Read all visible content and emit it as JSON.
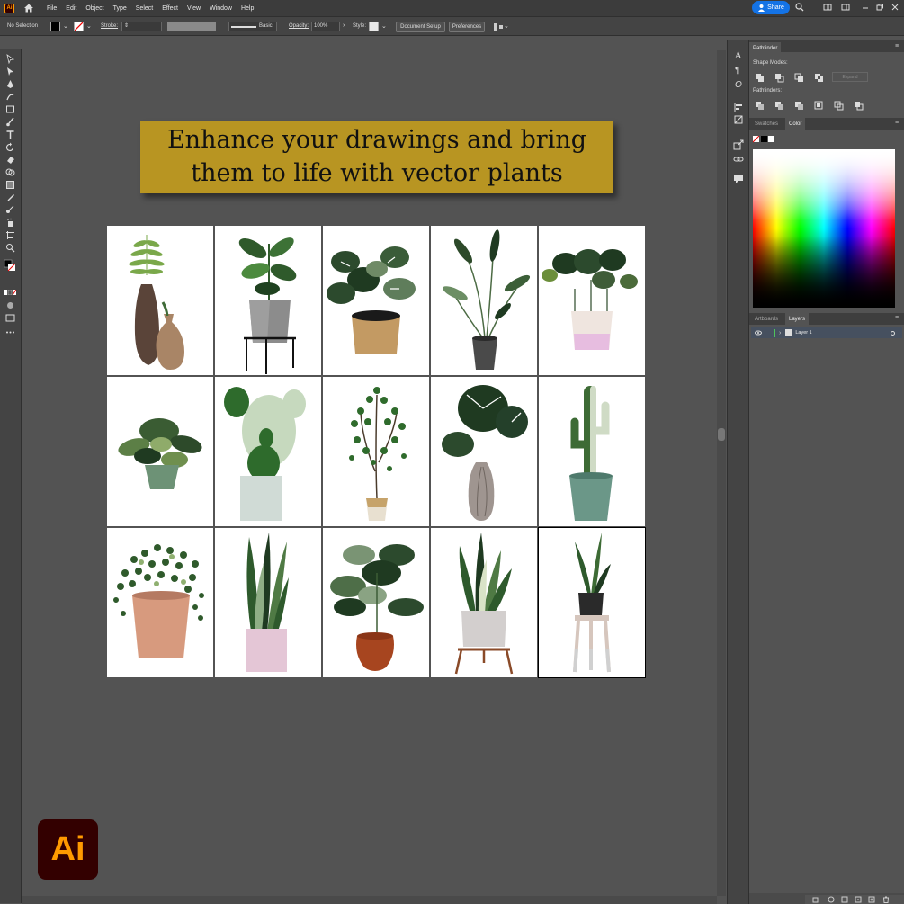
{
  "app": {
    "name": "Adobe Illustrator",
    "short": "Ai"
  },
  "menubar": {
    "items": [
      "File",
      "Edit",
      "Object",
      "Type",
      "Select",
      "Effect",
      "View",
      "Window",
      "Help"
    ],
    "share_label": "Share"
  },
  "control_bar": {
    "selection": "No Selection",
    "stroke_label": "Stroke:",
    "stroke_style": "Basic",
    "opacity_label": "Opacity:",
    "opacity_value": "100%",
    "style_label": "Style:",
    "document_setup": "Document Setup",
    "preferences": "Preferences"
  },
  "panels": {
    "pathfinder": {
      "title": "Pathfinder",
      "shape_modes": "Shape Modes:",
      "expand": "Expand",
      "pathfinders": "Pathfinders:"
    },
    "swatches_tab": "Swatches",
    "color_tab": "Color",
    "artboards_tab": "Artboards",
    "layers_tab": "Layers",
    "layer_name": "Layer 1"
  },
  "artwork": {
    "banner_line1": "Enhance your drawings and bring",
    "banner_line2": "them to life with vector plants",
    "grid": {
      "rows": 3,
      "cols": 5
    }
  },
  "colors": {
    "banner": "#b89522",
    "canvas": "#535353",
    "accent": "#1473e6",
    "ai_brand": "#ff9a00"
  }
}
